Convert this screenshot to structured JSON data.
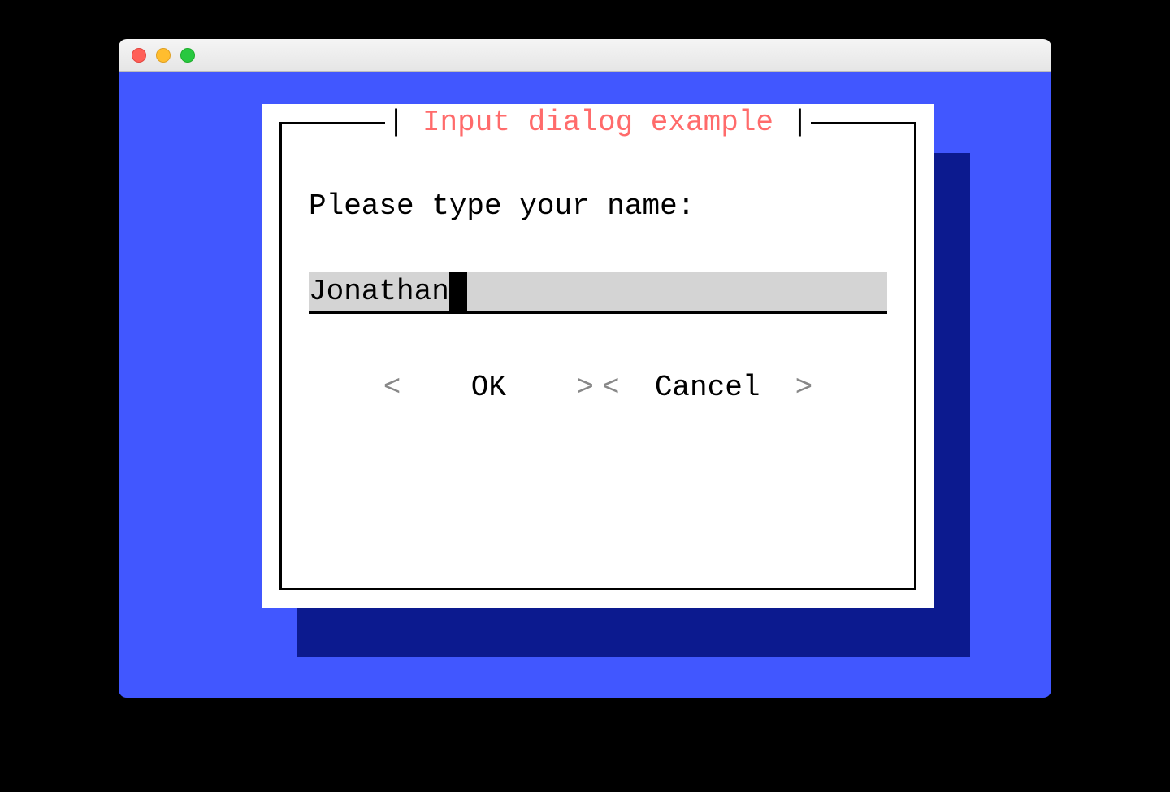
{
  "dialog": {
    "title": "Input dialog example",
    "prompt": "Please type your name:",
    "input_value": "Jonathan",
    "buttons": {
      "ok": "OK",
      "cancel": "Cancel"
    }
  }
}
